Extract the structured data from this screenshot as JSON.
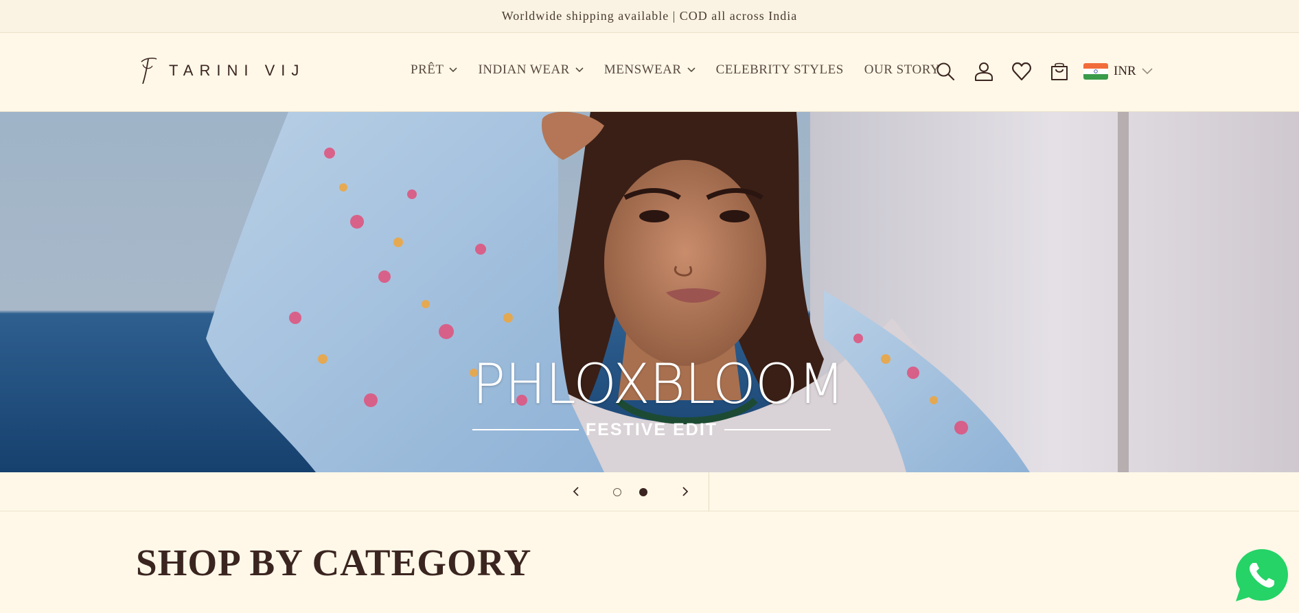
{
  "announcement": {
    "text": "Worldwide shipping available | COD all across India"
  },
  "header": {
    "logo_text": "TARINI VIJ",
    "nav": [
      {
        "label": "PRÊT",
        "has_dropdown": true
      },
      {
        "label": "INDIAN WEAR",
        "has_dropdown": true
      },
      {
        "label": "MENSWEAR",
        "has_dropdown": true
      },
      {
        "label": "CELEBRITY STYLES",
        "has_dropdown": false
      },
      {
        "label": "OUR STORY",
        "has_dropdown": false
      }
    ],
    "icons": [
      "search-icon",
      "account-icon",
      "wishlist-heart-icon",
      "cart-bag-icon"
    ],
    "currency": {
      "label": "INR",
      "flag": "india-flag-icon"
    }
  },
  "hero": {
    "title": "PHLOXBLOOM",
    "subtitle": "FESTIVE EDIT"
  },
  "slider": {
    "total_slides": 2,
    "active_slide": 2,
    "prev_icon": "chevron-left-icon",
    "next_icon": "chevron-right-icon"
  },
  "section": {
    "heading": "SHOP BY CATEGORY"
  },
  "floating": {
    "icon": "whatsapp-icon"
  },
  "colors": {
    "background": "#fff8e8",
    "text": "#3b2520",
    "whatsapp": "#25d366"
  }
}
